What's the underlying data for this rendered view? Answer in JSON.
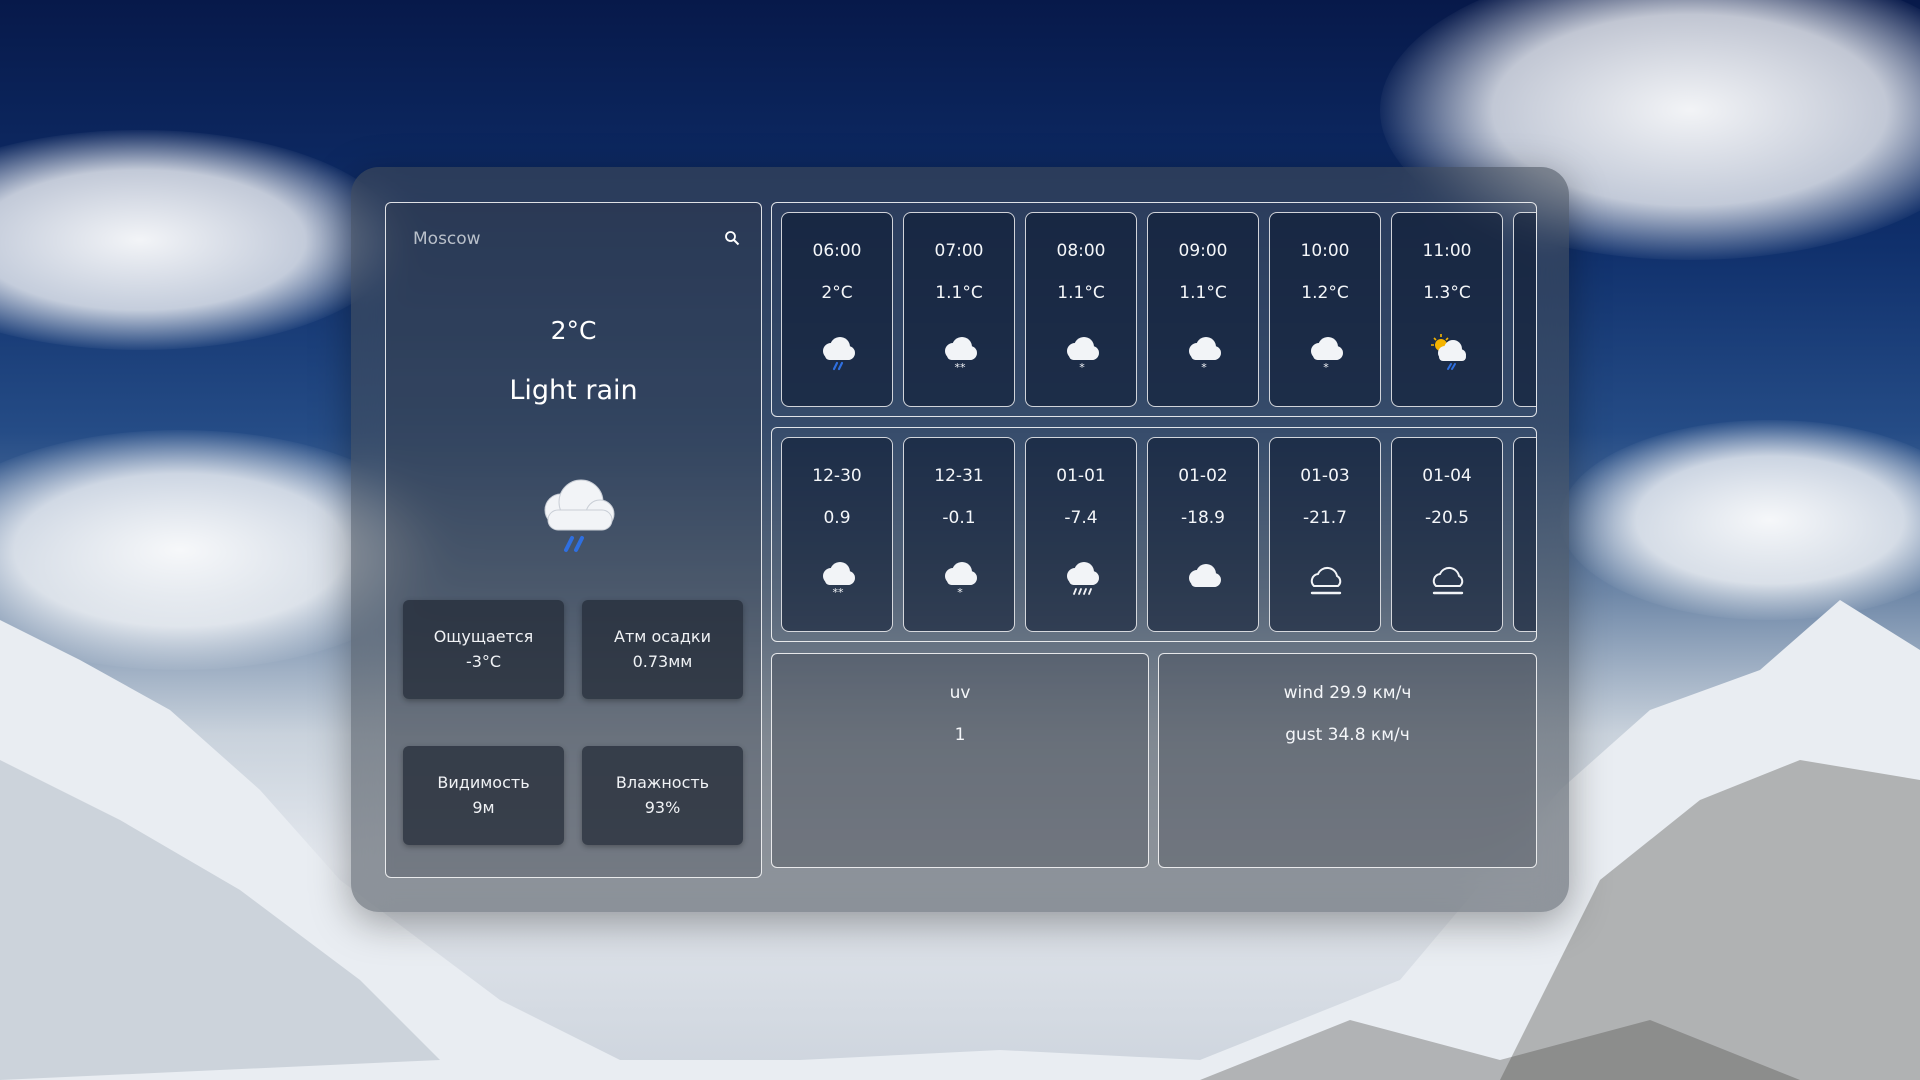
{
  "search": {
    "placeholder": "Moscow"
  },
  "current": {
    "temp": "2°C",
    "condition": "Light rain",
    "icon": "cloud-rain-icon"
  },
  "stats": [
    {
      "label": "Ощущается",
      "value": "-3°C"
    },
    {
      "label": "Атм осадки",
      "value": "0.73мм"
    },
    {
      "label": "Видимость",
      "value": "9м"
    },
    {
      "label": "Влажность",
      "value": "93%"
    }
  ],
  "hourly": [
    {
      "time": "06:00",
      "temp": "2°C",
      "icon": "cloud-rain-icon"
    },
    {
      "time": "07:00",
      "temp": "1.1°C",
      "icon": "cloud-snow-icon"
    },
    {
      "time": "08:00",
      "temp": "1.1°C",
      "icon": "cloud-light-snow-icon"
    },
    {
      "time": "09:00",
      "temp": "1.1°C",
      "icon": "cloud-light-snow-icon"
    },
    {
      "time": "10:00",
      "temp": "1.2°C",
      "icon": "cloud-light-snow-icon"
    },
    {
      "time": "11:00",
      "temp": "1.3°C",
      "icon": "sun-cloud-rain-icon"
    }
  ],
  "daily": [
    {
      "date": "12-30",
      "temp": "0.9",
      "icon": "cloud-snow-icon"
    },
    {
      "date": "12-31",
      "temp": "-0.1",
      "icon": "cloud-light-snow-icon"
    },
    {
      "date": "01-01",
      "temp": "-7.4",
      "icon": "cloud-sleet-icon"
    },
    {
      "date": "01-02",
      "temp": "-18.9",
      "icon": "cloud-icon"
    },
    {
      "date": "01-03",
      "temp": "-21.7",
      "icon": "cloud-fog-icon"
    },
    {
      "date": "01-04",
      "temp": "-20.5",
      "icon": "cloud-fog-icon"
    }
  ],
  "uv": {
    "label": "uv",
    "value": "1"
  },
  "wind": {
    "speed": "wind 29.9 км/ч",
    "gust": "gust 34.8 км/ч"
  },
  "colors": {
    "rain": "#2f6fe0",
    "sun": "#f5b400",
    "cloud": "#f2f4f7"
  }
}
